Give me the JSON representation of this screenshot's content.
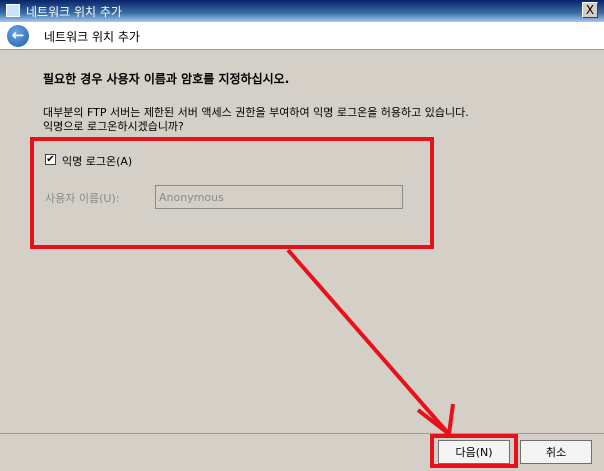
{
  "window": {
    "title": "네트워크 위치 추가",
    "close_label": "X"
  },
  "header": {
    "title": "네트워크 위치 추가"
  },
  "main": {
    "heading": "필요한 경우 사용자 이름과 암호를 지정하십시오.",
    "description_line1": "대부분의 FTP 서버는 제한된 서버 액세스 권한을 부여하여 익명 로그온을 허용하고 있습니다.",
    "description_line2": "익명으로 로그온하시겠습니까?",
    "anonymous_checkbox": {
      "label": "익명 로그온(A)",
      "checked": true
    },
    "username": {
      "label": "사용자 이름(U):",
      "value": "Anonymous"
    }
  },
  "footer": {
    "next_label": "다음(N)",
    "cancel_label": "취소"
  },
  "colors": {
    "annotation_red": "#e8101a",
    "titlebar_start": "#0a246a",
    "dialog_bg": "#d4d0c8"
  },
  "icons": {
    "back": "back-arrow-icon",
    "app": "network-location-icon",
    "close": "close-icon"
  }
}
